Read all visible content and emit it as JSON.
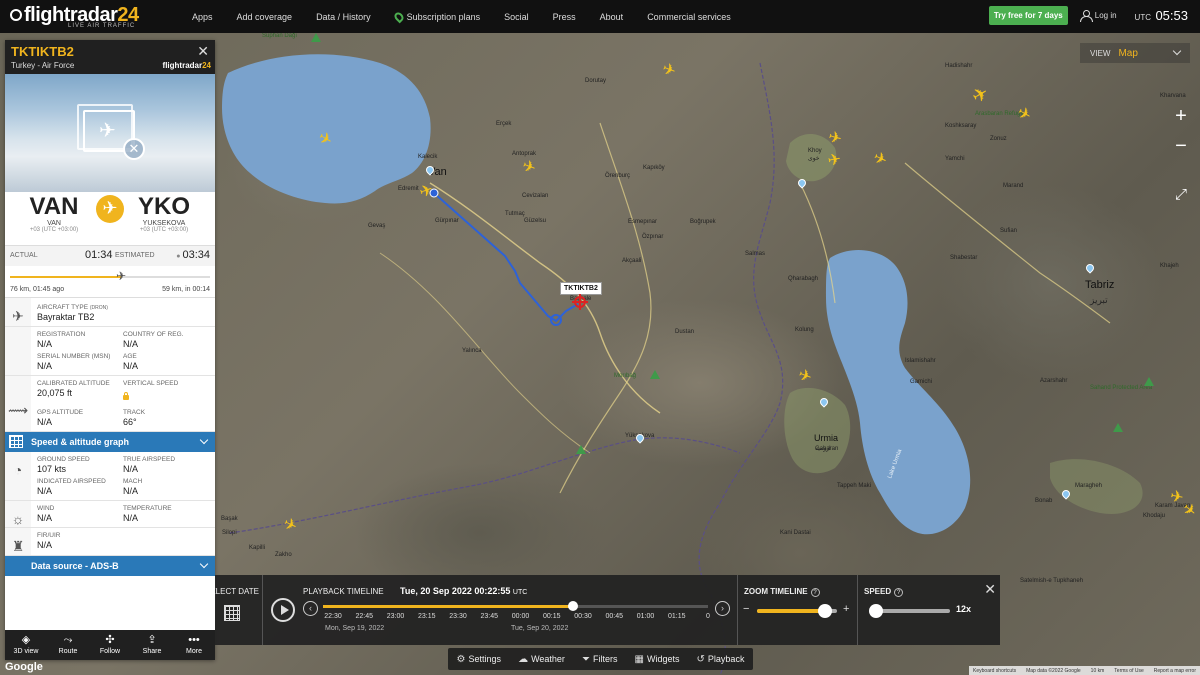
{
  "header": {
    "logo_main": "flightradar",
    "logo_num": "24",
    "logo_sub": "LIVE AIR TRAFFIC",
    "nav": [
      "Apps",
      "Add coverage",
      "Data / History",
      "Subscription plans",
      "Social",
      "Press",
      "About",
      "Commercial services"
    ],
    "try_button": "Try free for 7 days",
    "login": "Log in",
    "utc_label": "UTC",
    "clock": "05:53"
  },
  "map": {
    "view_label": "VIEW",
    "view_value": "Map",
    "flight_label": "TKTIKTB2",
    "places": {
      "van": "Van",
      "tabriz": "Tabriz",
      "tabriz_fa": "تبریز",
      "urmia": "Urmia",
      "urmia_fa": "ارومیه",
      "suphan": "Suphan Dağı",
      "ercek": "Erçek",
      "kalecik": "Kalecik",
      "edremit": "Edremit",
      "gevas": "Gevaş",
      "gurpinar": "Gürpınar",
      "tutmac": "Tutmaç",
      "cevizalan": "Cevizalan",
      "guzelsu": "Güzelsu",
      "baskale": "Başkale",
      "ozpinar": "Özpınar",
      "esmepinar": "Esmepınar",
      "bogrupek": "Boğrupek",
      "orenburc": "Örenburç",
      "kapikoy": "Kapıköy",
      "antoprak": "Antoprak",
      "dorutay": "Dorutay",
      "khoy": "Khoy",
      "khoy_fa": "خوی",
      "salmas": "Salmas",
      "qharabagh": "Qharabagh",
      "kolung": "Kolung",
      "shabestar": "Shabestar",
      "sufian": "Sufian",
      "marand": "Marand",
      "bonab": "Bonab",
      "maragheh": "Maragheh",
      "gabaran": "Gabaran",
      "tappeh_maki": "Tappeh Maki",
      "yuksekova": "Yüksekova",
      "lake_urmia": "Lake Urmia",
      "kani_dastai": "Kani Dastai",
      "silopi": "Silopi",
      "basak": "Başak",
      "kapilli": "Kapilli",
      "zakho": "Zakho",
      "dohuk": "Dohuk",
      "hadishahr": "Hadishahr",
      "ahar": "Ahar",
      "sahand": "Sahand",
      "kojur": "Khodaju",
      "karam_javan": "Karam Javan",
      "yamchi": "Yamchi",
      "zonuz": "Zonuz",
      "koshksaray": "Koshksaray",
      "qareh_zia": "Qareh Zia",
      "eyvoghli": "Eyvoghli",
      "dustan": "Dustan",
      "dogancik": "Doğancık",
      "yalinca": "Yalınca",
      "gamichi": "Gamichi",
      "islamishahr": "Islamishahr",
      "qoschi": "Qoschi",
      "azarshahr": "Azarshahr",
      "sahand_pa": "Sahand Protected Area",
      "arasbaran": "Arasbaran Refuge",
      "kharvana": "Kharvana",
      "khajeh": "Khajeh",
      "tazeh_kand": "Tazeh Kand",
      "vaniar": "Vaniar",
      "satelmish": "Satelmish-e Tupkhaneh",
      "mamaqan": "Mamaqan",
      "dehkhvareqan": "Dehkhvareqan",
      "sardrud": "Sardrud",
      "cevizlidere": "Cevizlidere",
      "mortbag": "Morıbağ",
      "sardar": "Sardar",
      "babakhdin": "Babakhdin",
      "hamir": "Hamır",
      "akcaali": "Akçaali",
      "pakakh": "Pakakh",
      "golo": "Gölo",
      "belen": "Belen",
      "mahmudiye": "Mahmudiye",
      "kadikoy": "Kadıköy",
      "zeynelkoy": "Zeynelköy",
      "ahmedi": "Ahmedi",
      "tashkik": "Tashkik",
      "gedikbulak": "Gedikbulak",
      "tabaniyeh": "Tabaniyeh",
      "gumusoluk": "Gümüşoluk",
      "cevizbuk": "Cevizbük",
      "cokekvaran": "Çokekvaran",
      "tasul": "Tasuj",
      "sigirli": "Sığırlı",
      "bekelin": "Bekelin",
      "halmeh": "Halmeh",
      "gewer": "Gewer",
      "vanyar": "Vanyar",
      "akdeniz": "Akdeniz"
    }
  },
  "flight": {
    "callsign": "TKTIKTB2",
    "operator": "Turkey - Air Force",
    "panel_logo_main": "flightradar",
    "panel_logo_num": "24",
    "origin_iata": "VAN",
    "origin_city": "VAN",
    "origin_tz": "+03 (UTC +03:00)",
    "dest_iata": "YKO",
    "dest_city": "YUKSEKOVA",
    "dest_tz": "+03 (UTC +03:00)",
    "actual_label": "ACTUAL",
    "actual_time": "01:34",
    "estimated_label": "ESTIMATED",
    "estimated_time": "03:34",
    "progress": 0.56,
    "dist_flown": "76 km, 01:45 ago",
    "dist_left": "59 km, in 00:14",
    "aircraft_type_label": "AIRCRAFT TYPE",
    "aircraft_type_sub": "(DRON)",
    "aircraft_type": "Bayraktar TB2",
    "registration_label": "REGISTRATION",
    "registration": "N/A",
    "country_label": "COUNTRY OF REG.",
    "country": "N/A",
    "serial_label": "SERIAL NUMBER (MSN)",
    "serial": "N/A",
    "age_label": "AGE",
    "age": "N/A",
    "cal_alt_label": "CALIBRATED ALTITUDE",
    "cal_alt": "20,075 ft",
    "vert_speed_label": "VERTICAL SPEED",
    "gps_alt_label": "GPS ALTITUDE",
    "gps_alt": "N/A",
    "track_label": "TRACK",
    "track": "66°",
    "graph_label": "Speed & altitude graph",
    "ground_speed_label": "GROUND SPEED",
    "ground_speed": "107 kts",
    "true_airspeed_label": "TRUE AIRSPEED",
    "true_airspeed": "N/A",
    "indicated_label": "INDICATED AIRSPEED",
    "indicated": "N/A",
    "mach_label": "MACH",
    "mach": "N/A",
    "wind_label": "WIND",
    "wind": "N/A",
    "temp_label": "TEMPERATURE",
    "temp": "N/A",
    "fir_label": "FIR/UIR",
    "fir": "N/A",
    "data_source_label": "Data source - ADS-B"
  },
  "panel_footer": [
    "3D view",
    "Route",
    "Follow",
    "Share",
    "More"
  ],
  "google": "Google",
  "playback": {
    "select_date": "SELECT DATE",
    "title": "PLAYBACK TIMELINE",
    "time": "Tue, 20 Sep 2022 00:22:55",
    "tz": "UTC",
    "progress": 0.65,
    "ticks": [
      "22:30",
      "22:45",
      "23:00",
      "23:15",
      "23:30",
      "23:45",
      "00:00",
      "00:15",
      "00:30",
      "00:45",
      "01:00",
      "01:15",
      "0"
    ],
    "day1": "Mon, Sep 19, 2022",
    "day2": "Tue, Sep 20, 2022",
    "zoom_title": "ZOOM TIMELINE",
    "zoom_level": 0.85,
    "speed_title": "SPEED",
    "speed_level": 0.0,
    "speed_value": "12x"
  },
  "toolbar": [
    "Settings",
    "Weather",
    "Filters",
    "Widgets",
    "Playback"
  ],
  "attribution": [
    "Keyboard shortcuts",
    "Map data ©2022 Google",
    "10 km",
    "Terms of Use",
    "Report a map error"
  ],
  "colors": {
    "accent": "#f0b41e",
    "track": "#2d62d8",
    "panel_blue": "#2a79b8"
  }
}
